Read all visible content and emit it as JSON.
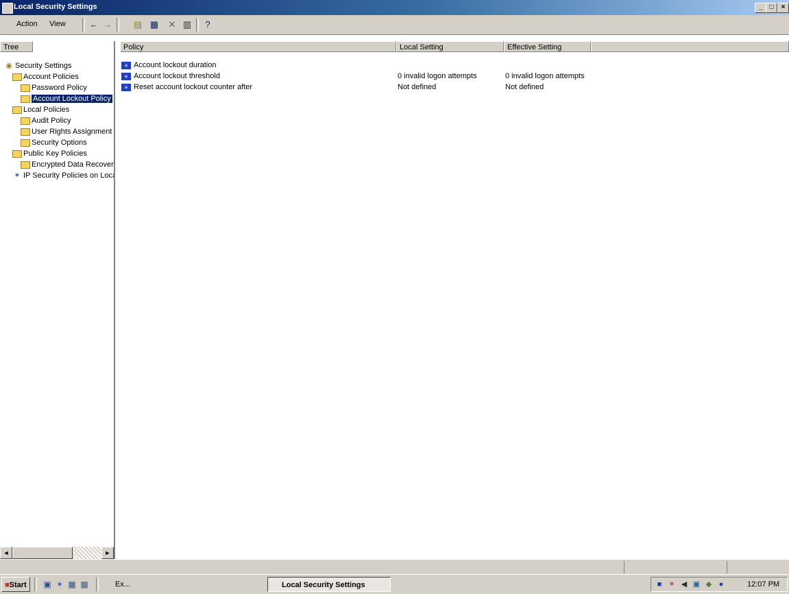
{
  "window": {
    "title": "Local Security Settings",
    "controls": {
      "minimize": "_",
      "maximize": "□",
      "close": "×"
    }
  },
  "menu": {
    "action": "Action",
    "view": "View"
  },
  "toolbar": {
    "icons": [
      "back-icon",
      "forward-icon",
      "up-folder-icon",
      "show-hide-tree-icon",
      "delete-icon",
      "properties-icon",
      "help-icon"
    ]
  },
  "tree": {
    "header": "Tree",
    "items": [
      {
        "label": "Security Settings",
        "indent": 0,
        "icon": "security-settings-icon"
      },
      {
        "label": "Account Policies",
        "indent": 1,
        "icon": "folder-icon"
      },
      {
        "label": "Password Policy",
        "indent": 2,
        "icon": "folder-icon"
      },
      {
        "label": "Account Lockout Policy",
        "indent": 2,
        "icon": "folder-icon",
        "selected": true
      },
      {
        "label": "Local Policies",
        "indent": 1,
        "icon": "folder-icon"
      },
      {
        "label": "Audit Policy",
        "indent": 2,
        "icon": "folder-icon"
      },
      {
        "label": "User Rights Assignment",
        "indent": 2,
        "icon": "folder-icon"
      },
      {
        "label": "Security Options",
        "indent": 2,
        "icon": "folder-icon"
      },
      {
        "label": "Public Key Policies",
        "indent": 1,
        "icon": "folder-icon"
      },
      {
        "label": "Encrypted Data Recovery Agents",
        "indent": 2,
        "icon": "folder-icon"
      },
      {
        "label": "IP Security Policies on Local Machine",
        "indent": 1,
        "icon": "ip-security-icon"
      }
    ]
  },
  "list": {
    "columns": [
      "Policy",
      "Local Setting",
      "Effective Setting"
    ],
    "rows": [
      {
        "policy": "Account lockout duration",
        "local": "",
        "effective": ""
      },
      {
        "policy": "Account lockout threshold",
        "local": "0 invalid logon attempts",
        "effective": "0 invalid logon attempts"
      },
      {
        "policy": "Reset account lockout counter after",
        "local": "Not defined",
        "effective": "Not defined"
      }
    ]
  },
  "taskbar": {
    "start": "Start",
    "tasks": [
      {
        "label": "Ex...",
        "active": false
      },
      {
        "label": "Local Security Settings",
        "active": true
      }
    ],
    "clock": "12:07 PM"
  }
}
